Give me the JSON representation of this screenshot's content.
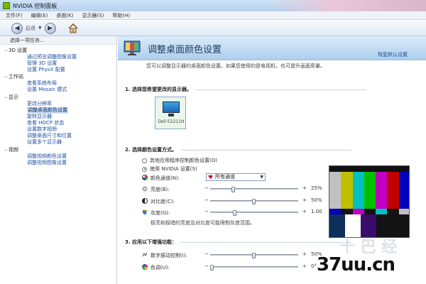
{
  "window": {
    "title": "NVIDIA 控制面板"
  },
  "menu": {
    "items": [
      "文件(F)",
      "编辑(E)",
      "桌面(K)",
      "显示器(S)",
      "帮助(H)"
    ]
  },
  "nav": {
    "back_label": "后退"
  },
  "sidebar": {
    "heading": "选择一项任务...",
    "items": [
      {
        "label": "3D 设置",
        "type": "cat",
        "expanded": true
      },
      {
        "label": "通过预览调整图像设置",
        "type": "sub"
      },
      {
        "label": "管理 3D 设置",
        "type": "sub"
      },
      {
        "label": "设置 PhysX 配置",
        "type": "sub"
      },
      {
        "label": "工作站",
        "type": "cat",
        "expanded": true
      },
      {
        "label": "查看系统布局",
        "type": "sub"
      },
      {
        "label": "设置 Mosaic 模式",
        "type": "sub"
      },
      {
        "label": "显示",
        "type": "cat",
        "expanded": true
      },
      {
        "label": "更改分辨率",
        "type": "sub"
      },
      {
        "label": "调整桌面颜色设置",
        "type": "sub",
        "selected": true
      },
      {
        "label": "旋转显示器",
        "type": "sub"
      },
      {
        "label": "查看 HDCP 状态",
        "type": "sub"
      },
      {
        "label": "设置数字视频",
        "type": "sub"
      },
      {
        "label": "调整桌面尺寸和位置",
        "type": "sub"
      },
      {
        "label": "设置多个显示器",
        "type": "sub"
      },
      {
        "label": "视频",
        "type": "cat",
        "expanded": true
      },
      {
        "label": "调整视频颜色设置",
        "type": "sub"
      },
      {
        "label": "调整视频图像设置",
        "type": "sub"
      }
    ]
  },
  "content": {
    "title": "调整桌面颜色设置",
    "restore_defaults": "恢复默认设置",
    "intro": "您可以调整显示器的桌面颜色设置。如果您使用的是电视机，也可提升画面质量。",
    "section1": "1. 选择您希望更改的显示器。",
    "monitor_label": "Dell E2211H",
    "section2": "2. 选择颜色设置方式。",
    "radio_other": "其他应用程序控制颜色设置(O)",
    "radio_nvidia": "使用 NVIDIA 设置(S)",
    "channel_label": "颜色通道(N):",
    "channel_value": "所有通道",
    "brightness": {
      "label": "亮度(B):",
      "value": "25%",
      "level": 0.25
    },
    "contrast": {
      "label": "对比度(C):",
      "value": "50%",
      "level": 0.5
    },
    "gamma": {
      "label": "灰度(G):",
      "value": "1.00",
      "level": 0.27
    },
    "note": "极亮和极暗的亮度及对比度可能限制灰度范围。",
    "section3": "3. 应用以下增强功能：",
    "vibrance": {
      "label": "数字振动控制(I):",
      "value": "50%",
      "level": 0.5
    },
    "hue": {
      "label": "色调(U):",
      "value": "0°",
      "level": 0.0
    }
  },
  "watermark": "37uu.cn",
  "faint_watermark": "十 巴 经",
  "colors": {
    "accent": "#1d5fb3",
    "banner": "#aecfed",
    "test_bars": [
      "#c0c0c0",
      "#c0c000",
      "#00c0c0",
      "#00c000",
      "#c000c0",
      "#c00000",
      "#0000c0"
    ],
    "test_midbars": [
      "#0000c0",
      "#131313",
      "#c000c0",
      "#131313",
      "#00c0c0",
      "#131313",
      "#c0c0c0"
    ]
  }
}
